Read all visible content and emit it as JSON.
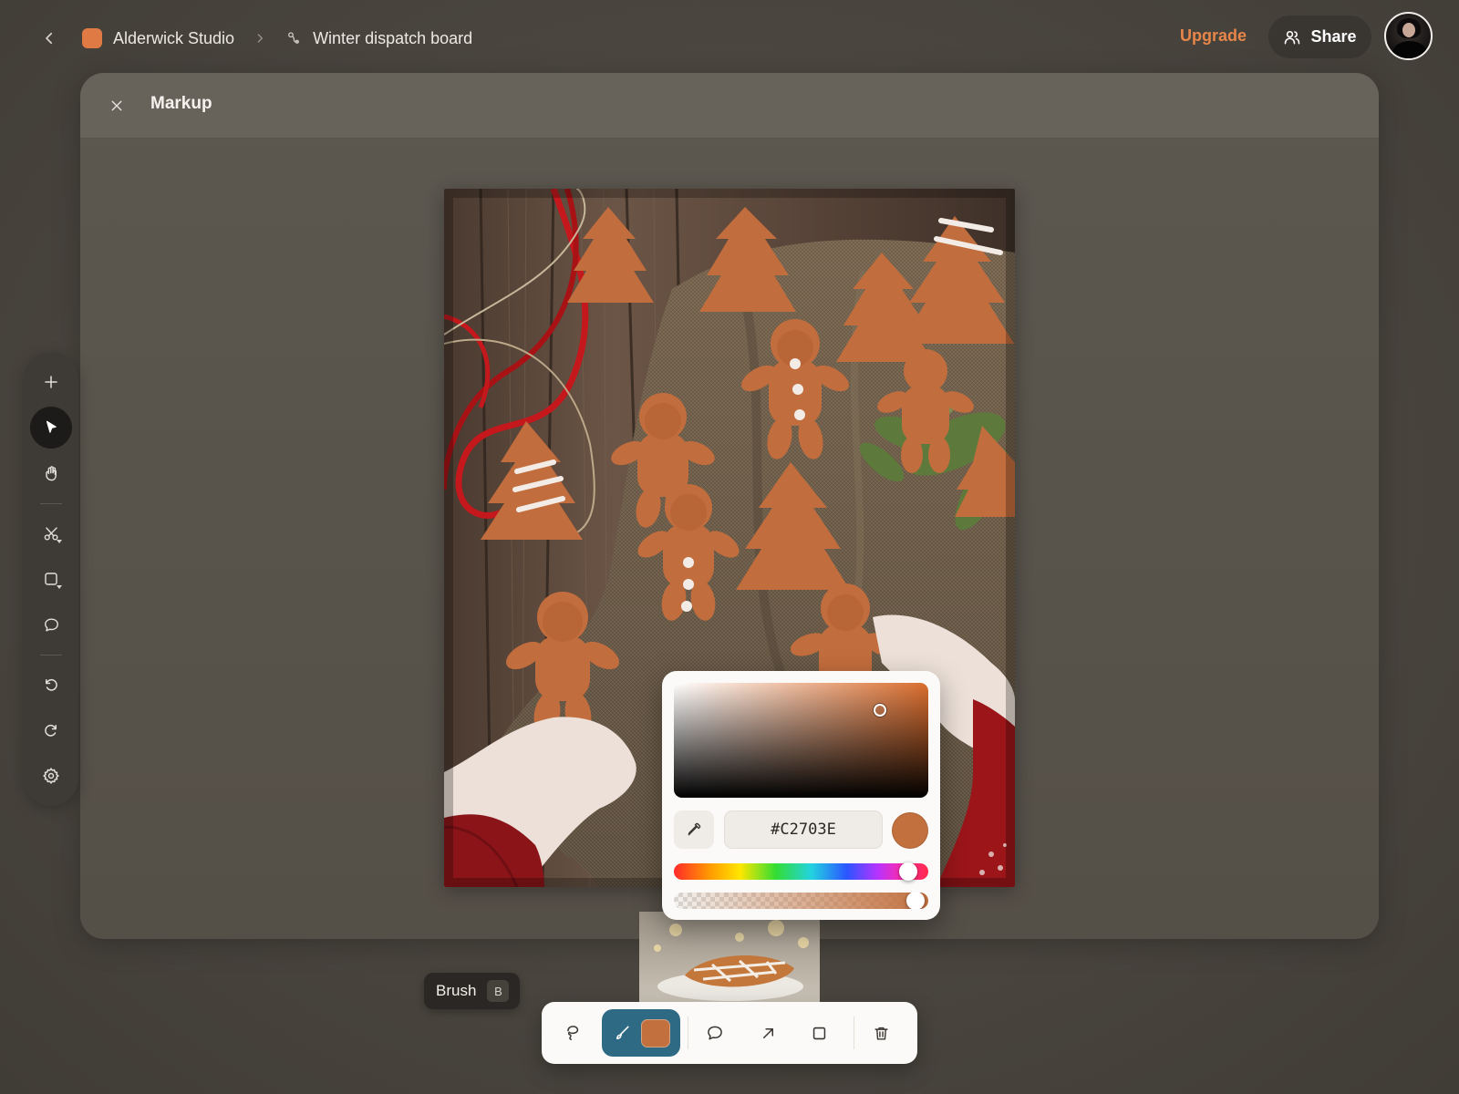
{
  "header": {
    "studio_name": "Alderwick Studio",
    "board_name": "Winter dispatch board",
    "upgrade_label": "Upgrade",
    "share_label": "Share"
  },
  "panel": {
    "title": "Markup"
  },
  "colors": {
    "accent": "#E8864A",
    "studio_swatch": "#E07A45",
    "brush_active_bg": "#2E6A83",
    "selected_color": "#C2703E"
  },
  "left_toolbar": {
    "tools": [
      {
        "name": "add",
        "icon": "plus-icon"
      },
      {
        "name": "select",
        "icon": "cursor-icon",
        "active": true
      },
      {
        "name": "pan",
        "icon": "hand-icon"
      },
      {
        "name": "cut",
        "icon": "scissors-icon"
      },
      {
        "name": "shape",
        "icon": "square-icon"
      },
      {
        "name": "comment",
        "icon": "speech-bubble-icon"
      },
      {
        "name": "undo",
        "icon": "undo-icon"
      },
      {
        "name": "redo",
        "icon": "redo-icon"
      },
      {
        "name": "settings",
        "icon": "gear-icon"
      }
    ]
  },
  "color_picker": {
    "hex_value": "#C2703E",
    "hue_position": 0.92,
    "alpha": 0.95,
    "saturation": 0.81,
    "brightness": 0.76
  },
  "tooltip": {
    "label": "Brush",
    "shortcut": "B"
  },
  "bottom_toolbar": {
    "tools": [
      {
        "name": "lasso",
        "icon": "lasso-icon"
      },
      {
        "name": "brush",
        "icon": "brush-icon",
        "active": true
      },
      {
        "name": "comment",
        "icon": "speech-bubble-icon"
      },
      {
        "name": "arrow",
        "icon": "arrow-icon"
      },
      {
        "name": "rectangle",
        "icon": "square-icon"
      },
      {
        "name": "delete",
        "icon": "trash-icon"
      }
    ]
  }
}
